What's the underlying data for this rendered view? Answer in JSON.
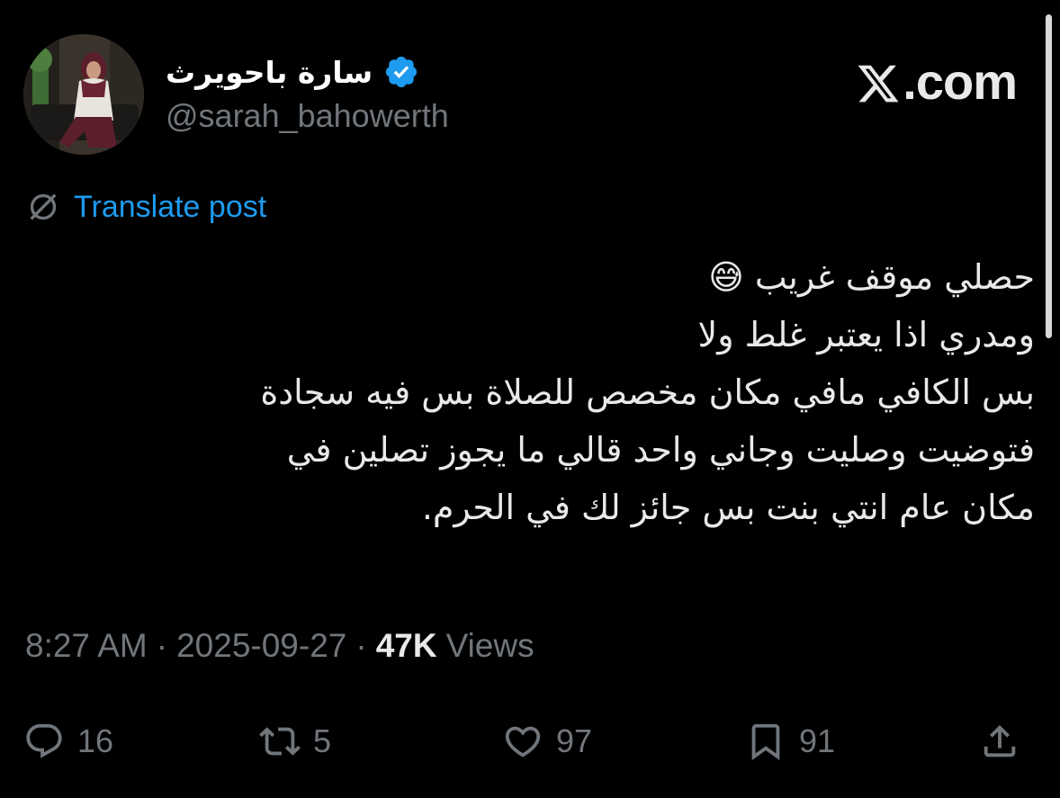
{
  "author": {
    "display_name": "سارة باحويرث",
    "handle": "@sarah_bahowerth",
    "verified_icon": "verified-badge-icon",
    "avatar": "profile-photo"
  },
  "brand": {
    "label": ".com"
  },
  "translate": {
    "label": "Translate post",
    "icon": "translate-globe-icon"
  },
  "post": {
    "lines": [
      "حصلي موقف غريب 😅",
      "ومدري اذا يعتبر غلط ولا",
      "بس الكافي مافي مكان مخصص للصلاة بس فيه سجادة",
      "فتوضيت وصليت وجاني واحد قالي ما يجوز تصلين في",
      "مكان عام انتي بنت بس جائز لك في الحرم."
    ]
  },
  "meta": {
    "time": "8:27 AM",
    "separator": "·",
    "date": "2025-09-27",
    "views_count": "47K",
    "views_label": "Views"
  },
  "actions": {
    "reply": {
      "icon": "reply-icon",
      "count": "16"
    },
    "repost": {
      "icon": "repost-icon",
      "count": "5"
    },
    "like": {
      "icon": "heart-icon",
      "count": "97"
    },
    "bookmark": {
      "icon": "bookmark-icon",
      "count": "91"
    },
    "share": {
      "icon": "share-icon"
    }
  },
  "colors": {
    "background": "#000000",
    "text": "#e7e9ea",
    "secondary": "#71767b",
    "link": "#1d9bf0",
    "verified": "#1d9bf0"
  }
}
